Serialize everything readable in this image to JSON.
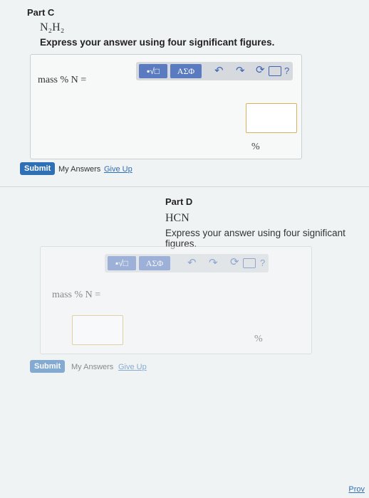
{
  "partC": {
    "label": "Part C",
    "formula": "N₂H₂",
    "instruction": "Express your answer using four significant figures.",
    "toolbar": {
      "templates": "▪√□",
      "greek": "ΑΣΦ",
      "undo": "↶",
      "redo": "↷",
      "reset": "⟳",
      "help": "?"
    },
    "input_label": "mass % N =",
    "unit": "%",
    "submit": "Submit",
    "my_answers": "My Answers",
    "give_up": "Give Up"
  },
  "partD": {
    "label": "Part D",
    "formula": "HCN",
    "instruction": "Express your answer using four significant figures.",
    "toolbar": {
      "templates": "▪√□",
      "greek": "ΑΣΦ",
      "undo": "↶",
      "redo": "↷",
      "reset": "⟳",
      "help": "?"
    },
    "input_label": "mass % N =",
    "unit": "%",
    "submit": "Submit",
    "my_answers": "My Answers",
    "give_up": "Give Up"
  },
  "corner_link": "Prov"
}
